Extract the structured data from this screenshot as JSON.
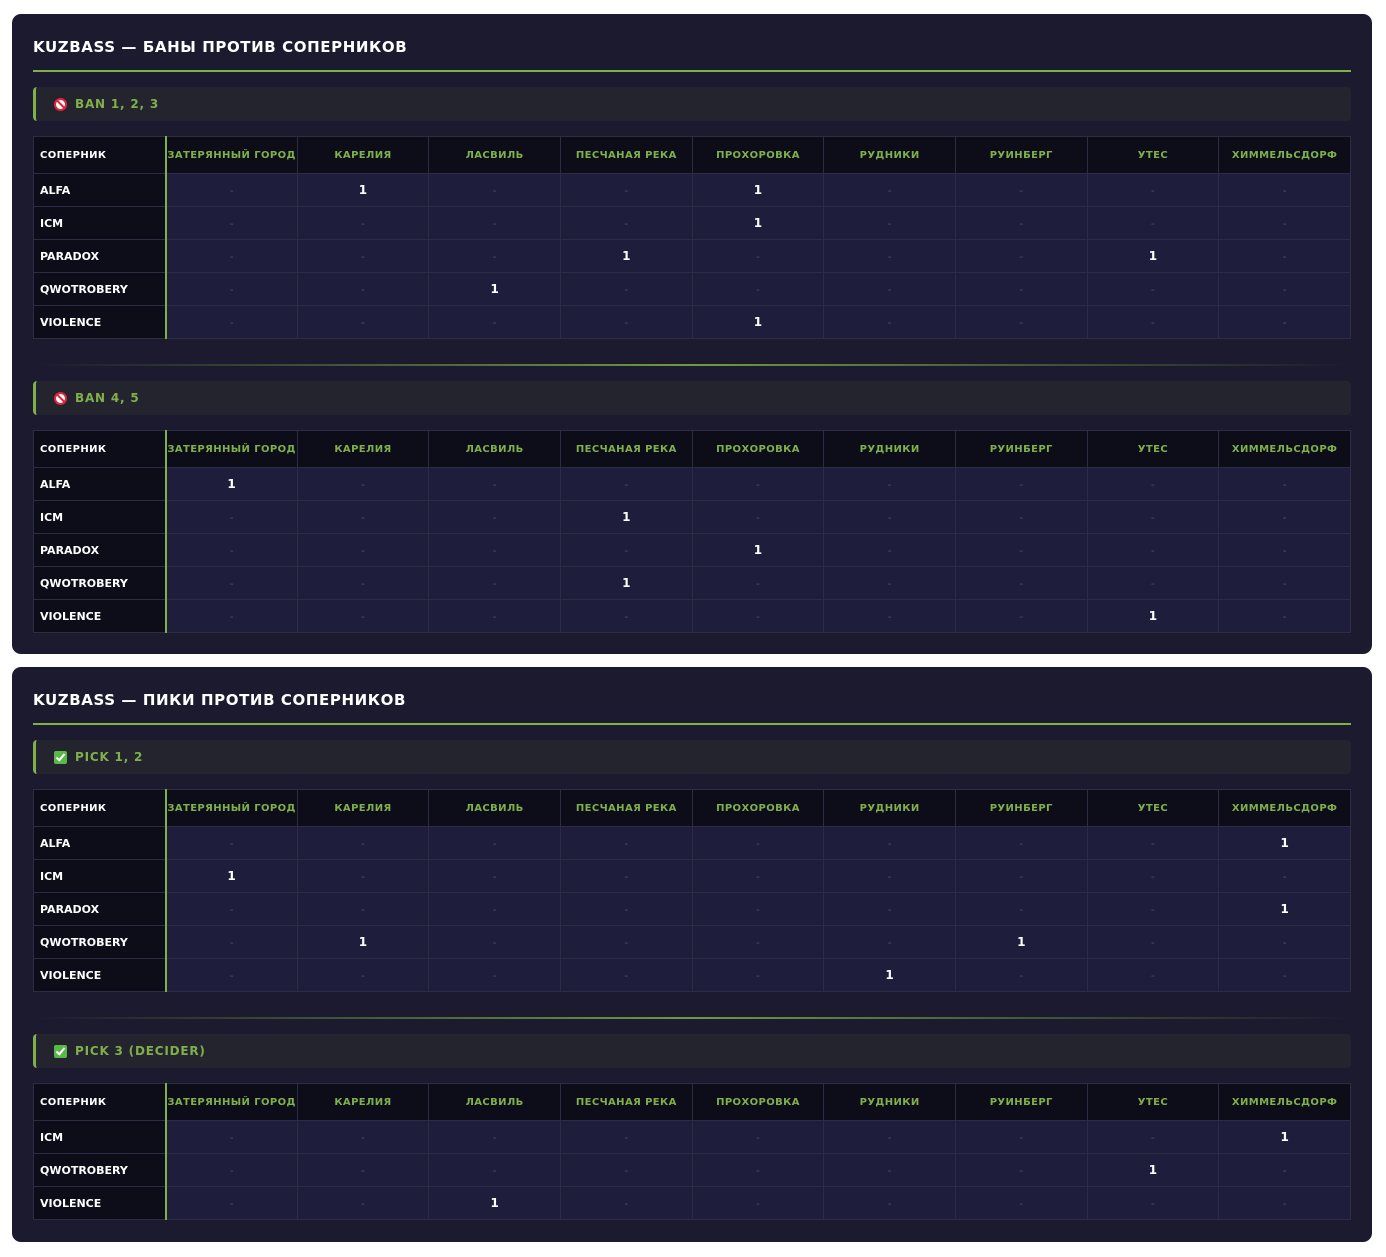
{
  "columns": {
    "opponent": "СОПЕРНИК",
    "maps": [
      "ЗАТЕРЯННЫЙ ГОРОД",
      "КАРЕЛИЯ",
      "ЛАСВИЛЬ",
      "ПЕСЧАНАЯ РЕКА",
      "ПРОХОРОВКА",
      "РУДНИКИ",
      "РУИНБЕРГ",
      "УТЕС",
      "ХИММЕЛЬСДОРФ"
    ]
  },
  "empty_cell": "-",
  "colors": {
    "accent": "#7fb04a",
    "card_bg": "#1b1a2f",
    "header_bg": "#0d0c19",
    "row_bg": "#1e1e3c",
    "ban_icon": "#e0243c",
    "pick_icon": "#59b84a"
  },
  "cards": [
    {
      "title": "KUZBASS — БАНЫ ПРОТИВ СОПЕРНИКОВ",
      "sections": [
        {
          "icon": "no-entry-icon",
          "label": "BAN 1, 2, 3",
          "rows": [
            {
              "opponent": "ALFA",
              "values": [
                "-",
                "1",
                "-",
                "-",
                "1",
                "-",
                "-",
                "-",
                "-"
              ]
            },
            {
              "opponent": "ICM",
              "values": [
                "-",
                "-",
                "-",
                "-",
                "1",
                "-",
                "-",
                "-",
                "-"
              ]
            },
            {
              "opponent": "PARADOX",
              "values": [
                "-",
                "-",
                "-",
                "1",
                "-",
                "-",
                "-",
                "1",
                "-"
              ]
            },
            {
              "opponent": "QWOTROBERY",
              "values": [
                "-",
                "-",
                "1",
                "-",
                "-",
                "-",
                "-",
                "-",
                "-"
              ]
            },
            {
              "opponent": "VIOLENCE",
              "values": [
                "-",
                "-",
                "-",
                "-",
                "1",
                "-",
                "-",
                "-",
                "-"
              ]
            }
          ]
        },
        {
          "icon": "no-entry-icon",
          "label": "BAN 4, 5",
          "rows": [
            {
              "opponent": "ALFA",
              "values": [
                "1",
                "-",
                "-",
                "-",
                "-",
                "-",
                "-",
                "-",
                "-"
              ]
            },
            {
              "opponent": "ICM",
              "values": [
                "-",
                "-",
                "-",
                "1",
                "-",
                "-",
                "-",
                "-",
                "-"
              ]
            },
            {
              "opponent": "PARADOX",
              "values": [
                "-",
                "-",
                "-",
                "-",
                "1",
                "-",
                "-",
                "-",
                "-"
              ]
            },
            {
              "opponent": "QWOTROBERY",
              "values": [
                "-",
                "-",
                "-",
                "1",
                "-",
                "-",
                "-",
                "-",
                "-"
              ]
            },
            {
              "opponent": "VIOLENCE",
              "values": [
                "-",
                "-",
                "-",
                "-",
                "-",
                "-",
                "-",
                "1",
                "-"
              ]
            }
          ]
        }
      ]
    },
    {
      "title": "KUZBASS — ПИКИ ПРОТИВ СОПЕРНИКОВ",
      "sections": [
        {
          "icon": "check-mark-icon",
          "label": "PICK 1, 2",
          "rows": [
            {
              "opponent": "ALFA",
              "values": [
                "-",
                "-",
                "-",
                "-",
                "-",
                "-",
                "-",
                "-",
                "1"
              ]
            },
            {
              "opponent": "ICM",
              "values": [
                "1",
                "-",
                "-",
                "-",
                "-",
                "-",
                "-",
                "-",
                "-"
              ]
            },
            {
              "opponent": "PARADOX",
              "values": [
                "-",
                "-",
                "-",
                "-",
                "-",
                "-",
                "-",
                "-",
                "1"
              ]
            },
            {
              "opponent": "QWOTROBERY",
              "values": [
                "-",
                "1",
                "-",
                "-",
                "-",
                "-",
                "1",
                "-",
                "-"
              ]
            },
            {
              "opponent": "VIOLENCE",
              "values": [
                "-",
                "-",
                "-",
                "-",
                "-",
                "1",
                "-",
                "-",
                "-"
              ]
            }
          ]
        },
        {
          "icon": "check-mark-icon",
          "label": "PICK 3 (DECIDER)",
          "rows": [
            {
              "opponent": "ICM",
              "values": [
                "-",
                "-",
                "-",
                "-",
                "-",
                "-",
                "-",
                "-",
                "1"
              ]
            },
            {
              "opponent": "QWOTROBERY",
              "values": [
                "-",
                "-",
                "-",
                "-",
                "-",
                "-",
                "-",
                "1",
                "-"
              ]
            },
            {
              "opponent": "VIOLENCE",
              "values": [
                "-",
                "-",
                "1",
                "-",
                "-",
                "-",
                "-",
                "-",
                "-"
              ]
            }
          ]
        }
      ]
    }
  ]
}
